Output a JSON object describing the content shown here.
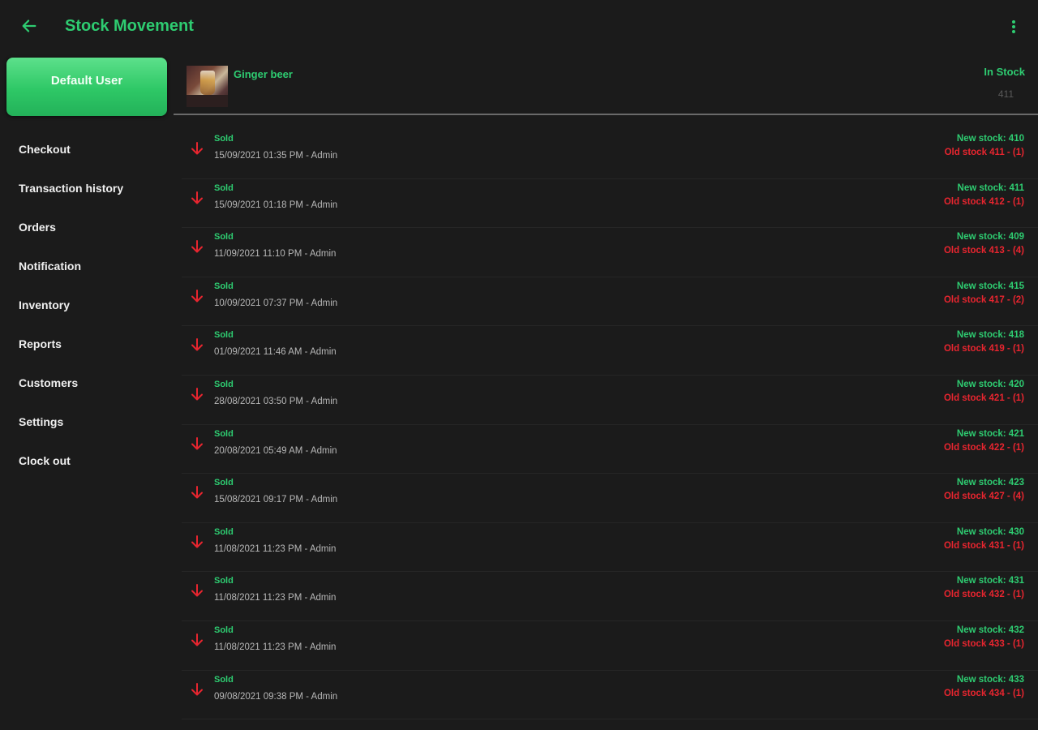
{
  "header": {
    "title": "Stock Movement",
    "back_icon": "arrow-left-icon",
    "more_icon": "more-vertical-icon",
    "accent": "#2ecc71"
  },
  "sidebar": {
    "user_label": "Default User",
    "items": [
      {
        "label": "Checkout"
      },
      {
        "label": "Transaction history"
      },
      {
        "label": "Orders"
      },
      {
        "label": "Notification"
      },
      {
        "label": "Inventory"
      },
      {
        "label": "Reports"
      },
      {
        "label": "Customers"
      },
      {
        "label": "Settings"
      },
      {
        "label": "Clock out"
      }
    ]
  },
  "product": {
    "name": "Ginger beer",
    "stock_label": "In Stock",
    "stock_value": "411"
  },
  "movements": [
    {
      "type": "Sold",
      "meta": "15/09/2021 01:35 PM - Admin",
      "new": "New stock: 410",
      "old": "Old stock 411 - (1)"
    },
    {
      "type": "Sold",
      "meta": "15/09/2021 01:18 PM - Admin",
      "new": "New stock: 411",
      "old": "Old stock 412 - (1)"
    },
    {
      "type": "Sold",
      "meta": "11/09/2021 11:10 PM - Admin",
      "new": "New stock: 409",
      "old": "Old stock 413 - (4)"
    },
    {
      "type": "Sold",
      "meta": "10/09/2021 07:37 PM - Admin",
      "new": "New stock: 415",
      "old": "Old stock 417 - (2)"
    },
    {
      "type": "Sold",
      "meta": "01/09/2021 11:46 AM - Admin",
      "new": "New stock: 418",
      "old": "Old stock 419 - (1)"
    },
    {
      "type": "Sold",
      "meta": "28/08/2021 03:50 PM - Admin",
      "new": "New stock: 420",
      "old": "Old stock 421 - (1)"
    },
    {
      "type": "Sold",
      "meta": "20/08/2021 05:49 AM - Admin",
      "new": "New stock: 421",
      "old": "Old stock 422 - (1)"
    },
    {
      "type": "Sold",
      "meta": "15/08/2021 09:17 PM - Admin",
      "new": "New stock: 423",
      "old": "Old stock 427 - (4)"
    },
    {
      "type": "Sold",
      "meta": "11/08/2021 11:23 PM - Admin",
      "new": "New stock: 430",
      "old": "Old stock 431 - (1)"
    },
    {
      "type": "Sold",
      "meta": "11/08/2021 11:23 PM - Admin",
      "new": "New stock: 431",
      "old": "Old stock 432 - (1)"
    },
    {
      "type": "Sold",
      "meta": "11/08/2021 11:23 PM - Admin",
      "new": "New stock: 432",
      "old": "Old stock 433 - (1)"
    },
    {
      "type": "Sold",
      "meta": "09/08/2021 09:38 PM - Admin",
      "new": "New stock: 433",
      "old": "Old stock 434 - (1)"
    }
  ]
}
